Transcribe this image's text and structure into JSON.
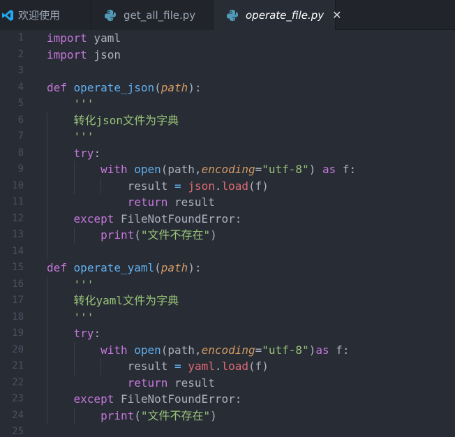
{
  "tabs": [
    {
      "label": "欢迎使用",
      "icon": "vscode-logo-icon",
      "active": false
    },
    {
      "label": "get_all_file.py",
      "icon": "python-icon",
      "active": false
    },
    {
      "label": "operate_file.py",
      "icon": "python-icon",
      "active": true
    }
  ],
  "close_glyph": "✕",
  "lines": [
    {
      "n": "1",
      "tokens": [
        {
          "t": "import",
          "c": "kw"
        },
        {
          "t": " yaml",
          "c": "txt"
        }
      ]
    },
    {
      "n": "2",
      "tokens": [
        {
          "t": "import",
          "c": "kw"
        },
        {
          "t": " json",
          "c": "txt"
        }
      ]
    },
    {
      "n": "3",
      "tokens": []
    },
    {
      "n": "4",
      "tokens": [
        {
          "t": "def",
          "c": "kw"
        },
        {
          "t": " ",
          "c": "txt"
        },
        {
          "t": "operate_json",
          "c": "fn"
        },
        {
          "t": "(",
          "c": "txt"
        },
        {
          "t": "path",
          "c": "prm"
        },
        {
          "t": "):",
          "c": "txt"
        }
      ]
    },
    {
      "n": "5",
      "tokens": [
        {
          "t": "    ",
          "c": "txt"
        },
        {
          "t": "'''",
          "c": "str"
        }
      ]
    },
    {
      "n": "6",
      "tokens": [
        {
          "t": "    ",
          "c": "txt"
        },
        {
          "t": "转化json文件为字典",
          "c": "str"
        }
      ]
    },
    {
      "n": "7",
      "tokens": [
        {
          "t": "    ",
          "c": "txt"
        },
        {
          "t": "'''",
          "c": "str"
        }
      ]
    },
    {
      "n": "8",
      "tokens": [
        {
          "t": "    ",
          "c": "txt"
        },
        {
          "t": "try",
          "c": "kw"
        },
        {
          "t": ":",
          "c": "txt"
        }
      ]
    },
    {
      "n": "9",
      "tokens": [
        {
          "t": "        ",
          "c": "txt"
        },
        {
          "t": "with",
          "c": "kw"
        },
        {
          "t": " ",
          "c": "txt"
        },
        {
          "t": "open",
          "c": "fn"
        },
        {
          "t": "(path,",
          "c": "txt"
        },
        {
          "t": "encoding",
          "c": "prm"
        },
        {
          "t": "=",
          "c": "txt"
        },
        {
          "t": "\"utf-8\"",
          "c": "str"
        },
        {
          "t": ") ",
          "c": "txt"
        },
        {
          "t": "as",
          "c": "kw"
        },
        {
          "t": " f:",
          "c": "txt"
        }
      ]
    },
    {
      "n": "10",
      "tokens": [
        {
          "t": "            result ",
          "c": "txt"
        },
        {
          "t": "=",
          "c": "fn"
        },
        {
          "t": " ",
          "c": "txt"
        },
        {
          "t": "json",
          "c": "mod"
        },
        {
          "t": ".",
          "c": "txt"
        },
        {
          "t": "load",
          "c": "mod"
        },
        {
          "t": "(f)",
          "c": "txt"
        }
      ]
    },
    {
      "n": "11",
      "tokens": [
        {
          "t": "            ",
          "c": "txt"
        },
        {
          "t": "return",
          "c": "kw"
        },
        {
          "t": " result",
          "c": "txt"
        }
      ]
    },
    {
      "n": "12",
      "tokens": [
        {
          "t": "    ",
          "c": "txt"
        },
        {
          "t": "except",
          "c": "kw"
        },
        {
          "t": " FileNotFoundError:",
          "c": "txt"
        }
      ]
    },
    {
      "n": "13",
      "tokens": [
        {
          "t": "        ",
          "c": "txt"
        },
        {
          "t": "print",
          "c": "kw"
        },
        {
          "t": "(",
          "c": "txt"
        },
        {
          "t": "\"文件不存在\"",
          "c": "str"
        },
        {
          "t": ")",
          "c": "txt"
        }
      ]
    },
    {
      "n": "14",
      "tokens": []
    },
    {
      "n": "15",
      "tokens": [
        {
          "t": "def",
          "c": "kw"
        },
        {
          "t": " ",
          "c": "txt"
        },
        {
          "t": "operate_yaml",
          "c": "fn"
        },
        {
          "t": "(",
          "c": "txt"
        },
        {
          "t": "path",
          "c": "prm"
        },
        {
          "t": "):",
          "c": "txt"
        }
      ]
    },
    {
      "n": "16",
      "tokens": [
        {
          "t": "    ",
          "c": "txt"
        },
        {
          "t": "'''",
          "c": "str"
        }
      ]
    },
    {
      "n": "17",
      "tokens": [
        {
          "t": "    ",
          "c": "txt"
        },
        {
          "t": "转化yaml文件为字典",
          "c": "str"
        }
      ]
    },
    {
      "n": "18",
      "tokens": [
        {
          "t": "    ",
          "c": "txt"
        },
        {
          "t": "'''",
          "c": "str"
        }
      ]
    },
    {
      "n": "19",
      "tokens": [
        {
          "t": "    ",
          "c": "txt"
        },
        {
          "t": "try",
          "c": "kw"
        },
        {
          "t": ":",
          "c": "txt"
        }
      ]
    },
    {
      "n": "20",
      "tokens": [
        {
          "t": "        ",
          "c": "txt"
        },
        {
          "t": "with",
          "c": "kw"
        },
        {
          "t": " ",
          "c": "txt"
        },
        {
          "t": "open",
          "c": "fn"
        },
        {
          "t": "(path,",
          "c": "txt"
        },
        {
          "t": "encoding",
          "c": "prm"
        },
        {
          "t": "=",
          "c": "txt"
        },
        {
          "t": "\"utf-8\"",
          "c": "str"
        },
        {
          "t": ")",
          "c": "txt"
        },
        {
          "t": "as",
          "c": "kw"
        },
        {
          "t": " f:",
          "c": "txt"
        }
      ]
    },
    {
      "n": "21",
      "tokens": [
        {
          "t": "            result ",
          "c": "txt"
        },
        {
          "t": "=",
          "c": "fn"
        },
        {
          "t": " ",
          "c": "txt"
        },
        {
          "t": "yaml",
          "c": "mod"
        },
        {
          "t": ".",
          "c": "txt"
        },
        {
          "t": "load",
          "c": "mod"
        },
        {
          "t": "(f)",
          "c": "txt"
        }
      ]
    },
    {
      "n": "22",
      "tokens": [
        {
          "t": "            ",
          "c": "txt"
        },
        {
          "t": "return",
          "c": "kw"
        },
        {
          "t": " result",
          "c": "txt"
        }
      ]
    },
    {
      "n": "23",
      "tokens": [
        {
          "t": "    ",
          "c": "txt"
        },
        {
          "t": "except",
          "c": "kw"
        },
        {
          "t": " FileNotFoundError:",
          "c": "txt"
        }
      ]
    },
    {
      "n": "24",
      "tokens": [
        {
          "t": "        ",
          "c": "txt"
        },
        {
          "t": "print",
          "c": "kw"
        },
        {
          "t": "(",
          "c": "txt"
        },
        {
          "t": "\"文件不存在\"",
          "c": "str"
        },
        {
          "t": ")",
          "c": "txt"
        }
      ]
    },
    {
      "n": "25",
      "tokens": []
    }
  ],
  "theme": {
    "keyword": "#c678dd",
    "function": "#61afef",
    "parameter": "#d19a66",
    "string": "#98c379",
    "module": "#e06c75",
    "text": "#abb2bf",
    "background": "#282c34",
    "tabbar": "#21252b",
    "vscode_blue": "#23a9f2",
    "python_blue": "#519aba"
  }
}
